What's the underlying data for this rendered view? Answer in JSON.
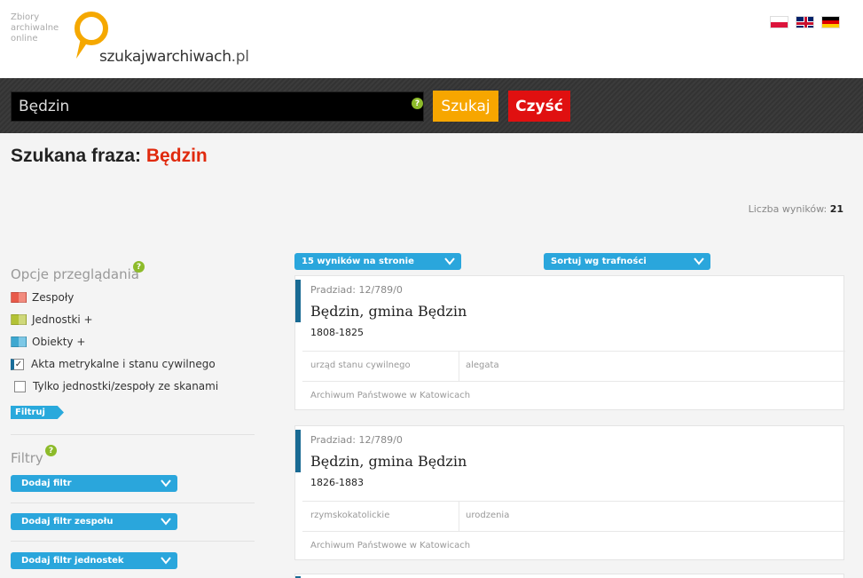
{
  "header": {
    "logo_small": [
      "Zbiory",
      "archiwalne",
      "online"
    ],
    "logo_name": "szukajwarchiwach",
    "logo_tld": ".pl",
    "languages": [
      "polski",
      "English",
      "Deutsch"
    ]
  },
  "search": {
    "value": "Będzin",
    "help": "?",
    "search_label": "Szukaj",
    "clear_label": "Czyść"
  },
  "phrase": {
    "label": "Szukana fraza: ",
    "term": "Będzin"
  },
  "results_count": {
    "label": "Liczba wyników: ",
    "value": "21"
  },
  "sidebar": {
    "options_title": "Opcje przeglądania",
    "help": "?",
    "options": [
      {
        "label": "Zespoły",
        "type": "swatch",
        "color": "#e85a4a"
      },
      {
        "label": "Jednostki +",
        "type": "swatch",
        "color": "#b3c236"
      },
      {
        "label": "Obiekty +",
        "type": "swatch",
        "color": "#3ea8d0"
      },
      {
        "label": "Akta metrykalne i stanu cywilnego",
        "type": "checkbox",
        "checked": true
      },
      {
        "label": "Tylko jednostki/zespoły ze skanami",
        "type": "checkbox",
        "checked": false
      }
    ],
    "filter_button": "Filtruj",
    "filters_title": "Filtry",
    "filters": [
      "Dodaj filtr",
      "Dodaj filtr zespołu",
      "Dodaj filtr jednostek"
    ]
  },
  "controls": {
    "per_page": "15 wyników na stronie",
    "sort": "Sortuj wg trafności"
  },
  "results": [
    {
      "signature": "Pradziad: 12/789/0",
      "name": "Będzin, gmina Będzin",
      "dates": "1808-1825",
      "type": "urząd stanu cywilnego",
      "kind": "alegata",
      "archive": "Archiwum Państwowe w Katowicach"
    },
    {
      "signature": "Pradziad: 12/789/0",
      "name": "Będzin, gmina Będzin",
      "dates": "1826-1883",
      "type": "rzymskokatolickie",
      "kind": "urodzenia",
      "archive": "Archiwum Państwowe w Katowicach"
    }
  ],
  "colors": {
    "accent_blue": "#2aa6dc",
    "search_orange": "#f7a600",
    "clear_red": "#e01010",
    "phrase_red": "#e02a0e",
    "card_marker": "#196a93"
  }
}
